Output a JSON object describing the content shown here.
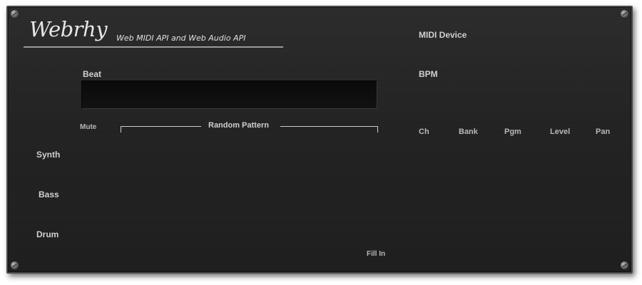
{
  "header": {
    "logo_text": "Webrhy",
    "subtitle": "Web MIDI API and Web Audio API"
  },
  "left": {
    "beat_label": "Beat",
    "mute_label": "Mute",
    "random_pattern_label": "Random Pattern",
    "tracks": [
      "Synth",
      "Bass",
      "Drum"
    ],
    "fill_in_label": "Fill In"
  },
  "right": {
    "midi_device_label": "MIDI Device",
    "bpm_label": "BPM",
    "columns": [
      "Ch",
      "Bank",
      "Pgm",
      "Level",
      "Pan"
    ]
  }
}
